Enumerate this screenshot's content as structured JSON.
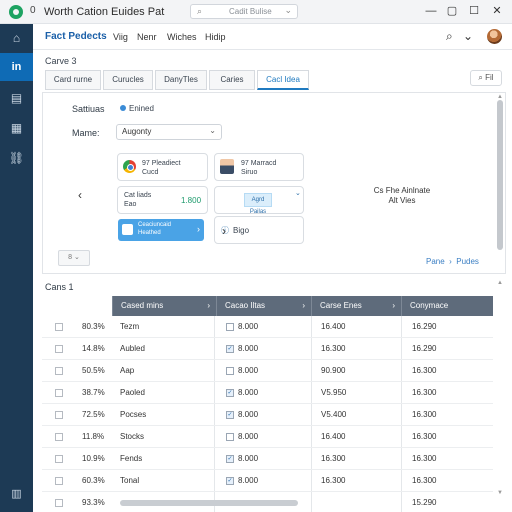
{
  "window": {
    "back_glyph": "0",
    "title": "Worth Cation Euides Pat",
    "search_placeholder": "Cadit Bulise"
  },
  "sidebar": {
    "items": [
      "home-icon",
      "in",
      "list-icon",
      "doc-icon",
      "link-icon",
      "clipboard-icon"
    ]
  },
  "topnav": {
    "brand": "Fact Pedects",
    "items": [
      "Viig",
      "Nenr",
      "Wiches",
      "Hidip"
    ]
  },
  "breadcrumb": "Carve 3",
  "tabs": [
    "Card rurne",
    "Curucles",
    "DanyTles",
    "Caries",
    "Cacl Idea"
  ],
  "filter_label": "Fil",
  "detail": {
    "status_label": "Sattiuas",
    "status_value": "Enined",
    "name_label": "Mame:",
    "name_value": "Augonty",
    "card1_line1": "97 Pleadiect",
    "card1_line2": "Cucd",
    "card2_line1": "97 Marracd",
    "card2_line2": "Siruo",
    "card3_line1": "Cat liads",
    "card3_line2": "Eao",
    "card3_value": "1.800",
    "card4_chip": "Agrd Pailas",
    "tile_line1": "Ceaciuncaid",
    "tile_line2": "Heathed",
    "card5_label": "Bigo",
    "right_text_line1": "Cs Fhe Ainlnate",
    "right_text_line2": "Alt Vies",
    "mini_select": "8 ⌄",
    "pager_label": "Pane",
    "pager_next": "Pudes"
  },
  "table": {
    "title": "Cans 1",
    "headers": [
      "Cased mins",
      "Cacao Iltas",
      "Carse Enes",
      "Conymace"
    ],
    "rows": [
      {
        "pct": "80.3%",
        "name": "Tezm",
        "val1": "8.000",
        "checked": false,
        "val2": "16.400",
        "val3": "16.290"
      },
      {
        "pct": "14.8%",
        "name": "Aubled",
        "val1": "8.000",
        "checked": true,
        "val2": "16.300",
        "val3": "16.290"
      },
      {
        "pct": "50.5%",
        "name": "Aap",
        "val1": "8.000",
        "checked": false,
        "val2": "90.900",
        "val3": "16.300"
      },
      {
        "pct": "38.7%",
        "name": "Paoled",
        "val1": "8.000",
        "checked": true,
        "val2": "V5.950",
        "val3": "16.300"
      },
      {
        "pct": "72.5%",
        "name": "Pocses",
        "val1": "8.000",
        "checked": true,
        "val2": "V5.400",
        "val3": "16.300"
      },
      {
        "pct": "11.8%",
        "name": "Stocks",
        "val1": "8.000",
        "checked": false,
        "val2": "16.400",
        "val3": "16.300"
      },
      {
        "pct": "10.9%",
        "name": "Fends",
        "val1": "8.000",
        "checked": true,
        "val2": "16.300",
        "val3": "16.300"
      },
      {
        "pct": "60.3%",
        "name": "Tonal",
        "val1": "8.000",
        "checked": true,
        "val2": "16.300",
        "val3": "16.300"
      },
      {
        "pct": "93.3%",
        "name": "",
        "val1": "",
        "checked": false,
        "val2": "",
        "val3": "15.290"
      }
    ]
  },
  "colors": {
    "sidebar_bg": "#1d3a55",
    "sidebar_active": "#0f6bb5",
    "accent": "#1f7ac0",
    "table_header": "#5e6b7b"
  }
}
